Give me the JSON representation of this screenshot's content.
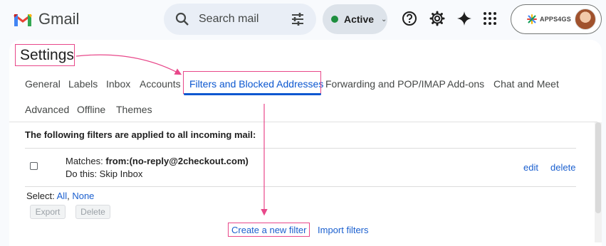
{
  "app": {
    "name": "Gmail"
  },
  "search": {
    "placeholder": "Search mail"
  },
  "status": {
    "label": "Active"
  },
  "account": {
    "brand": "APPS4GS"
  },
  "settings": {
    "title": "Settings"
  },
  "tabs": {
    "row1": [
      "General",
      "Labels",
      "Inbox",
      "Accounts",
      "Filters and Blocked Addresses",
      "Forwarding and POP/IMAP",
      "Add-ons",
      "Chat and Meet"
    ],
    "row2": [
      "Advanced",
      "Offline",
      "Themes"
    ],
    "active": "Filters and Blocked Addresses"
  },
  "filters": {
    "heading": "The following filters are applied to all incoming mail:",
    "items": [
      {
        "matches_label": "Matches: ",
        "matches_value": "from:(no-reply@2checkout.com)",
        "action": "Do this: Skip Inbox",
        "edit": "edit",
        "delete": "delete"
      }
    ],
    "select_label": "Select: ",
    "select_all": "All",
    "select_sep": ", ",
    "select_none": "None",
    "export": "Export",
    "delete_button": "Delete",
    "create": "Create a new filter",
    "import": "Import filters"
  },
  "colors": {
    "accent": "#0b57d0",
    "highlight": "#e8488a",
    "link": "#1a5fcf",
    "status_green": "#1e8e3e"
  }
}
